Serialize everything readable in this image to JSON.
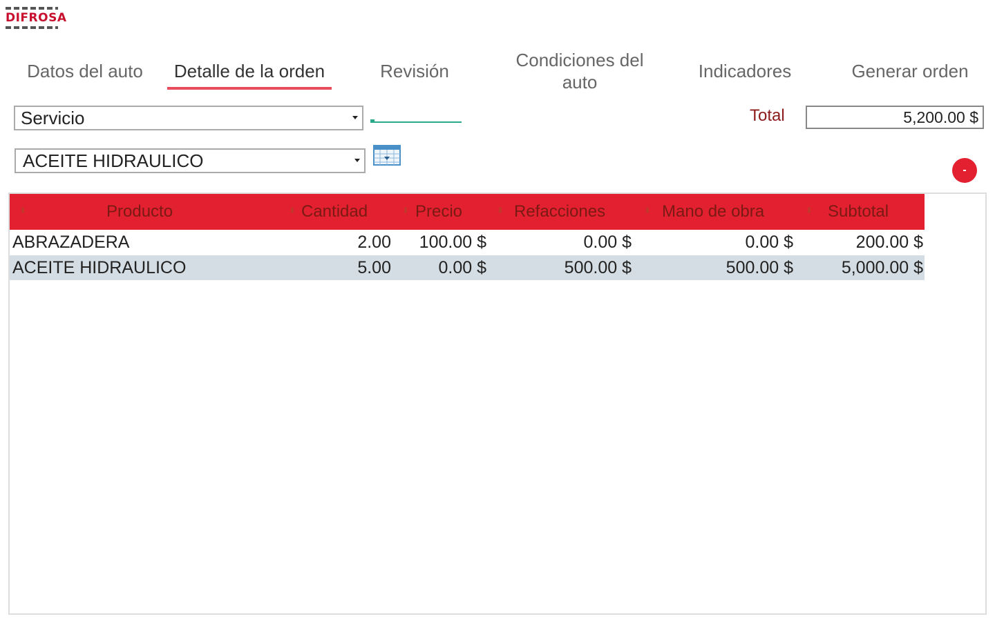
{
  "brand": {
    "name": "DIFROSA",
    "color": "#c8102e"
  },
  "tabs": [
    {
      "label": "Datos del auto"
    },
    {
      "label": "Detalle de la orden",
      "active": true
    },
    {
      "label": "Revisión"
    },
    {
      "label": "Condiciones del auto"
    },
    {
      "label": "Indicadores"
    },
    {
      "label": "Generar orden"
    }
  ],
  "filters": {
    "type_select": {
      "value": "Servicio"
    },
    "product_select": {
      "value": "ACEITE HIDRAULICO"
    }
  },
  "total": {
    "label": "Total",
    "value": "5,200.00 $"
  },
  "icons": {
    "calendar": "calendar-icon",
    "add": "add-circle-icon",
    "sort": "sort-icon"
  },
  "colors": {
    "accent": "#e3202f",
    "header_text": "#7a1a14",
    "active_underline": "#e84c5d",
    "row_highlight": "#d4dde3",
    "total_label": "#8b1a1a"
  },
  "table": {
    "columns": [
      "Producto",
      "Cantidad",
      "Precio",
      "Refacciones",
      "Mano de obra",
      "Subtotal"
    ],
    "rows": [
      [
        "ABRAZADERA",
        "2.00",
        "100.00 $",
        "0.00 $",
        "0.00 $",
        "200.00 $"
      ],
      [
        "ACEITE HIDRAULICO",
        "5.00",
        "0.00 $",
        "500.00 $",
        "500.00 $",
        "5,000.00 $"
      ]
    ]
  }
}
